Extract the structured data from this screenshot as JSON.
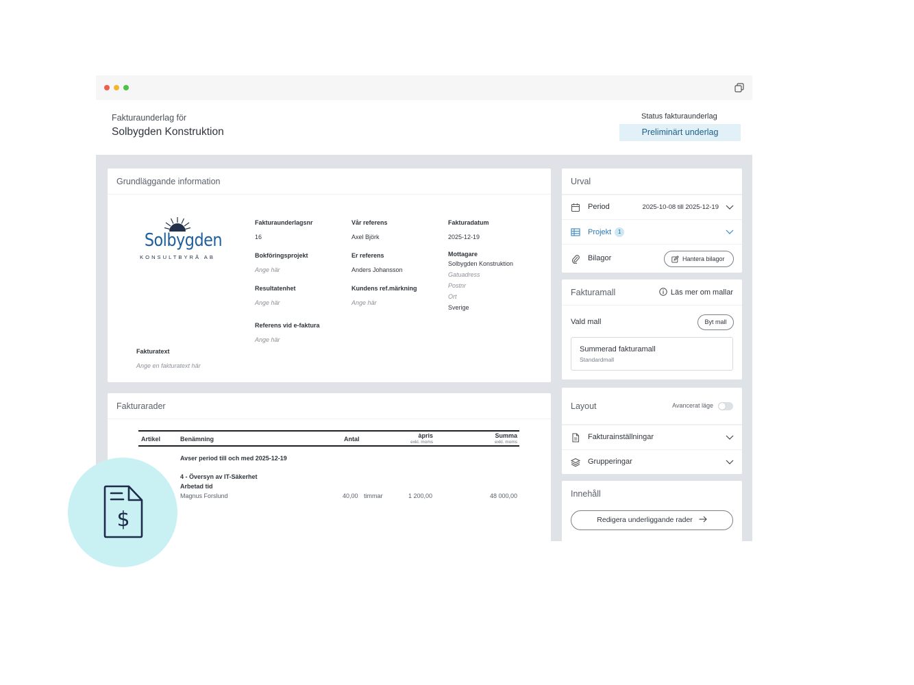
{
  "header": {
    "subtitle": "Fakturaunderlag för",
    "title": "Solbygden Konstruktion",
    "status_label": "Status fakturaunderlag",
    "status_value": "Preliminärt underlag"
  },
  "info": {
    "heading": "Grundläggande information",
    "logo": {
      "name": "Solbygden",
      "tagline": "KONSULTBYRÅ AB"
    },
    "fields": {
      "nr_label": "Fakturaunderlagsnr",
      "nr_value": "16",
      "bokf_label": "Bokföringsprojekt",
      "bokf_value": "Ange här",
      "res_label": "Resultatenhet",
      "res_value": "Ange här",
      "ref_e_label": "Referens vid e-faktura",
      "ref_e_value": "Ange här",
      "var_ref_label": "Vår referens",
      "var_ref_value": "Axel Björk",
      "er_ref_label": "Er referens",
      "er_ref_value": "Anders Johansson",
      "kund_label": "Kundens ref.märkning",
      "kund_value": "Ange här",
      "datum_label": "Fakturadatum",
      "datum_value": "2025-12-19",
      "mottagare_label": "Mottagare",
      "mottagare_name": "Solbygden Konstruktion",
      "gata": "Gatuadress",
      "postnr": "Postnr",
      "ort": "Ort",
      "land": "Sverige",
      "text_label": "Fakturatext",
      "text_value": "Ange en fakturatext här"
    }
  },
  "rows": {
    "heading": "Fakturarader",
    "columns": {
      "artikel": "Artikel",
      "benamning": "Benämning",
      "antal": "Antal",
      "apris": "àpris",
      "apris_sub": "exkl. moms",
      "summa": "Summa",
      "summa_sub": "exkl. moms"
    },
    "period_line": "Avser period till och med 2025-12-19",
    "group": "4 - Översyn av IT-Säkerhet",
    "subgroup": "Arbetad tid",
    "line": {
      "name": "Magnus Forslund",
      "antal": "40,00",
      "unit": "timmar",
      "apris": "1 200,00",
      "summa": "48 000,00"
    }
  },
  "urval": {
    "heading": "Urval",
    "period_label": "Period",
    "period_value": "2025-10-08 till 2025-12-19",
    "projekt_label": "Projekt",
    "projekt_count": "1",
    "bilagor_label": "Bilagor",
    "bilagor_button": "Hantera bilagor"
  },
  "mall": {
    "heading": "Fakturamall",
    "info_link": "Läs mer om mallar",
    "vald_label": "Vald mall",
    "byt_button": "Byt mall",
    "selected_name": "Summerad fakturamall",
    "selected_sub": "Standardmall"
  },
  "layout": {
    "heading": "Layout",
    "advanced_label": "Avancerat läge",
    "settings_label": "Fakturainställningar",
    "groups_label": "Grupperingar"
  },
  "innehall": {
    "heading": "Innehåll",
    "edit_button": "Redigera underliggande rader"
  },
  "colors": {
    "accent": "#1c6aa0",
    "status_bg": "#e2f1f8",
    "bubble": "#c9f1f3"
  }
}
